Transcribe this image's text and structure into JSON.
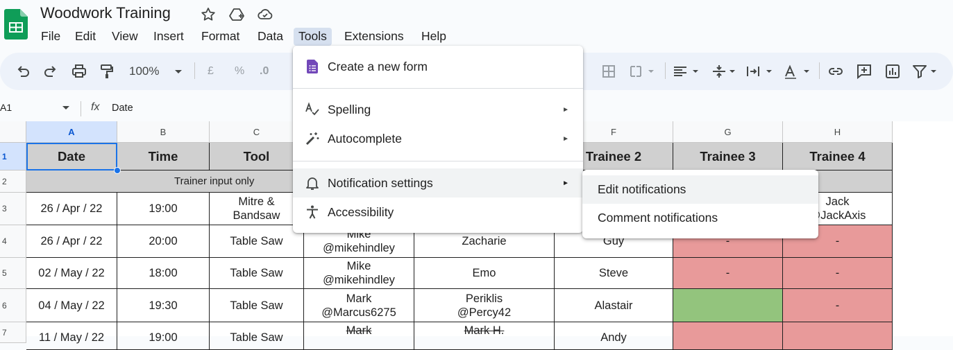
{
  "app": {
    "doc_title": "Woodwork Training",
    "logo_icon": "sheets-logo-icon",
    "title_icons": [
      "star-icon",
      "move-to-drive-icon",
      "cloud-saved-icon"
    ]
  },
  "menubar": {
    "items": [
      "File",
      "Edit",
      "View",
      "Insert",
      "Format",
      "Data",
      "Tools",
      "Extensions",
      "Help"
    ],
    "active": "Tools"
  },
  "toolbar": {
    "zoom": "100%",
    "currency": "£",
    "percent": "%",
    "decimal": ".0"
  },
  "formula_bar": {
    "name_box": "A1",
    "fx": "fx",
    "value": "Date"
  },
  "sheet": {
    "columns": [
      "A",
      "B",
      "C",
      "D",
      "E",
      "F",
      "G",
      "H"
    ],
    "selected_column": "A",
    "rows": [
      "1",
      "2",
      "3",
      "4",
      "5",
      "6",
      "7"
    ],
    "selected_row": "1",
    "header_cells": {
      "a1": "Date",
      "b1": "Time",
      "c1": "Tool",
      "f1": "Trainee 2",
      "g1": "Trainee 3",
      "h1": "Trainee 4"
    },
    "row2_text": "Trainer input only",
    "row3": {
      "a": "26 / Apr / 22",
      "b": "19:00",
      "c": "Mitre &\nBandsaw",
      "h": "Jack\n@JackAxis"
    },
    "row4": {
      "a": "26 / Apr / 22",
      "b": "20:00",
      "c": "Table Saw",
      "d": "Mike\n@mikehindley",
      "e": "Zacharie",
      "f": "Guy",
      "g": "-",
      "h": "-"
    },
    "row5": {
      "a": "02 / May / 22",
      "b": "18:00",
      "c": "Table Saw",
      "d": "Mike\n@mikehindley",
      "e": "Emo",
      "f": "Steve",
      "g": "-",
      "h": "-"
    },
    "row6": {
      "a": "04 / May / 22",
      "b": "19:30",
      "c": "Table Saw",
      "d": "Mark\n@Marcus6275",
      "e": "Periklis\n@Percy42",
      "f": "Alastair",
      "g": "",
      "h": "-"
    },
    "row7": {
      "a": "11 / May / 22",
      "b": "19:00",
      "c": "Table Saw",
      "d": "Mark",
      "e": "Mark H.",
      "f": "Andy"
    },
    "colors": {
      "header_gray": "#d0d0d0",
      "red": "#e89a9a",
      "green": "#93c47d",
      "selection": "#1a73e8"
    }
  },
  "tools_menu": {
    "items": [
      {
        "label": "Create a new form",
        "icon": "forms-icon",
        "submenu": false
      },
      {
        "label": "Spelling",
        "icon": "spelling-icon",
        "submenu": true
      },
      {
        "label": "Autocomplete",
        "icon": "magic-wand-icon",
        "submenu": true
      },
      {
        "label": "Notification settings",
        "icon": "bell-icon",
        "submenu": true
      },
      {
        "label": "Accessibility",
        "icon": "accessibility-icon",
        "submenu": false
      }
    ],
    "submenu_arrow": "►",
    "highlighted": "Notification settings"
  },
  "notifications_submenu": {
    "items": [
      "Edit notifications",
      "Comment notifications"
    ],
    "highlighted": "Edit notifications"
  }
}
